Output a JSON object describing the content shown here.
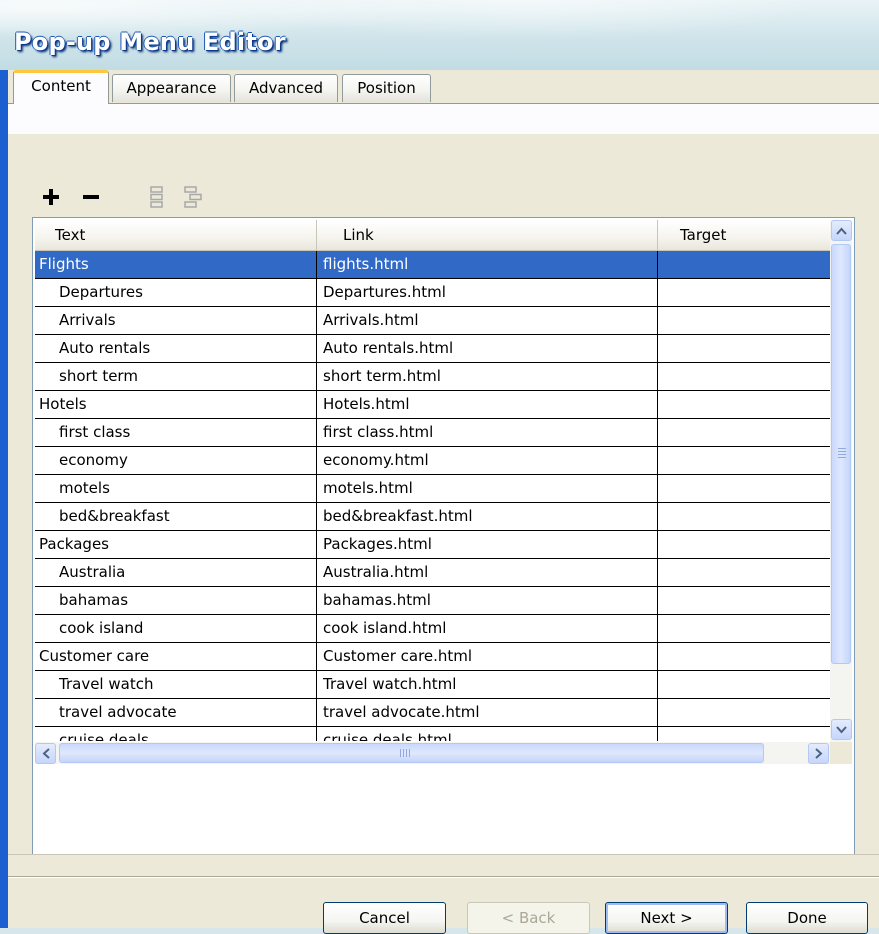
{
  "window": {
    "title": "Pop-up Menu Editor"
  },
  "tabs": [
    {
      "label": "Content",
      "active": true
    },
    {
      "label": "Appearance",
      "active": false
    },
    {
      "label": "Advanced",
      "active": false
    },
    {
      "label": "Position",
      "active": false
    }
  ],
  "toolbar": {
    "add_icon": "plus-icon",
    "remove_icon": "minus-icon",
    "indent_icon": "indent-icon",
    "outdent_icon": "outdent-icon"
  },
  "grid": {
    "columns": [
      "Text",
      "Link",
      "Target"
    ],
    "rows": [
      {
        "text": "Flights",
        "link": "flights.html",
        "target": "",
        "child": false,
        "selected": true
      },
      {
        "text": "Departures",
        "link": "Departures.html",
        "target": "",
        "child": true
      },
      {
        "text": "Arrivals",
        "link": "Arrivals.html",
        "target": "",
        "child": true
      },
      {
        "text": "Auto rentals",
        "link": "Auto rentals.html",
        "target": "",
        "child": true
      },
      {
        "text": "short term",
        "link": "short term.html",
        "target": "",
        "child": true
      },
      {
        "text": "Hotels",
        "link": "Hotels.html",
        "target": "",
        "child": false
      },
      {
        "text": "first class",
        "link": "first class.html",
        "target": "",
        "child": true
      },
      {
        "text": "economy",
        "link": "economy.html",
        "target": "",
        "child": true
      },
      {
        "text": "motels",
        "link": "motels.html",
        "target": "",
        "child": true
      },
      {
        "text": "bed&breakfast",
        "link": "bed&breakfast.html",
        "target": "",
        "child": true
      },
      {
        "text": "Packages",
        "link": "Packages.html",
        "target": "",
        "child": false
      },
      {
        "text": "Australia",
        "link": "Australia.html",
        "target": "",
        "child": true
      },
      {
        "text": "bahamas",
        "link": "bahamas.html",
        "target": "",
        "child": true
      },
      {
        "text": "cook island",
        "link": "cook island.html",
        "target": "",
        "child": true
      },
      {
        "text": "Customer care",
        "link": "Customer care.html",
        "target": "",
        "child": false
      },
      {
        "text": "Travel watch",
        "link": "Travel watch.html",
        "target": "",
        "child": true
      },
      {
        "text": "travel advocate",
        "link": "travel advocate.html",
        "target": "",
        "child": true
      },
      {
        "text": "cruise deals",
        "link": "cruise deals.html",
        "target": "",
        "child": true
      }
    ]
  },
  "buttons": {
    "cancel": "Cancel",
    "back": "< Back",
    "next": "Next >",
    "done": "Done"
  },
  "colors": {
    "selection": "#3169c6",
    "title_bar": "#0a52c9",
    "active_tab_accent": "#ffc83c"
  }
}
